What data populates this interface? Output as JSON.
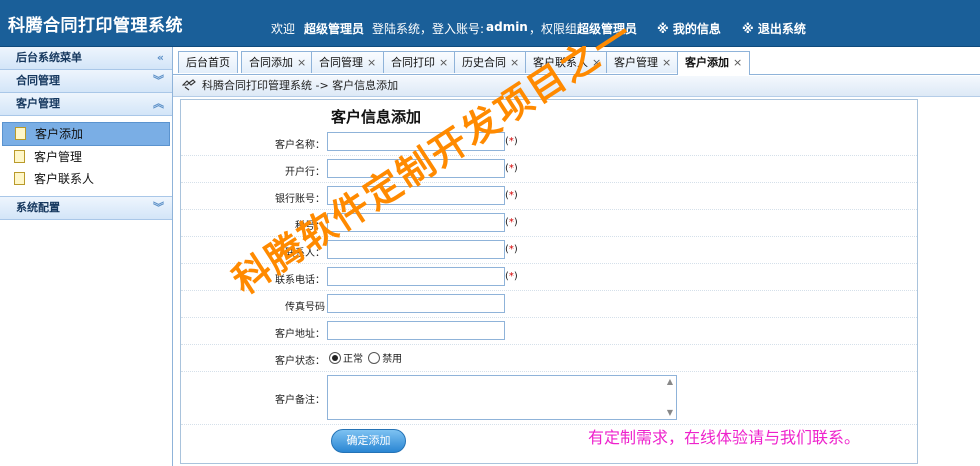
{
  "header": {
    "app_title": "科腾合同打印管理系统",
    "welcome": "欢迎",
    "user_name": "超级管理员",
    "login_info_prefix": "登陆系统，登入账号:",
    "account": "admin",
    "group_prefix": "，权限组:",
    "group": "超级管理员",
    "my_info": "※ 我的信息",
    "logout": "※ 退出系统"
  },
  "sidebar": {
    "menu_title": "后台系统菜单",
    "sections": [
      {
        "label": "合同管理"
      },
      {
        "label": "客户管理"
      },
      {
        "label": "系统配置"
      }
    ],
    "items": [
      {
        "label": "客户添加"
      },
      {
        "label": "客户管理"
      },
      {
        "label": "客户联系人"
      }
    ]
  },
  "tabs": [
    {
      "label": "后台首页"
    },
    {
      "label": "合同添加"
    },
    {
      "label": "合同管理"
    },
    {
      "label": "合同打印"
    },
    {
      "label": "历史合同"
    },
    {
      "label": "客户联系人"
    },
    {
      "label": "客户管理"
    },
    {
      "label": "客户添加"
    }
  ],
  "breadcrumb": "科腾合同打印管理系统 -> 客户信息添加",
  "form": {
    "title": "客户信息添加",
    "required_open": "(",
    "required_mark": "*",
    "required_close": ")",
    "fields": [
      {
        "label": "客户名称：",
        "value": ""
      },
      {
        "label": "开户行：",
        "value": ""
      },
      {
        "label": "银行账号：",
        "value": ""
      },
      {
        "label": "税号：",
        "value": ""
      },
      {
        "label": "联系人：",
        "value": ""
      },
      {
        "label": "联系电话：",
        "value": ""
      },
      {
        "label": "传真号码",
        "value": ""
      },
      {
        "label": "客户地址：",
        "value": ""
      }
    ],
    "status_label": "客户状态：",
    "status_options": [
      "正常",
      "禁用"
    ],
    "status_selected": "正常",
    "remark_label": "客户备注：",
    "remark_value": "",
    "submit_label": "确定添加"
  },
  "watermark": "科腾软件定制开发项目之一",
  "promo": "有定制需求，在线体验请与我们联系。",
  "colors": {
    "header_bg": "#1a5f99",
    "watermark": "#ff8a00",
    "promo": "#ee22cc",
    "required": "#d40000"
  }
}
